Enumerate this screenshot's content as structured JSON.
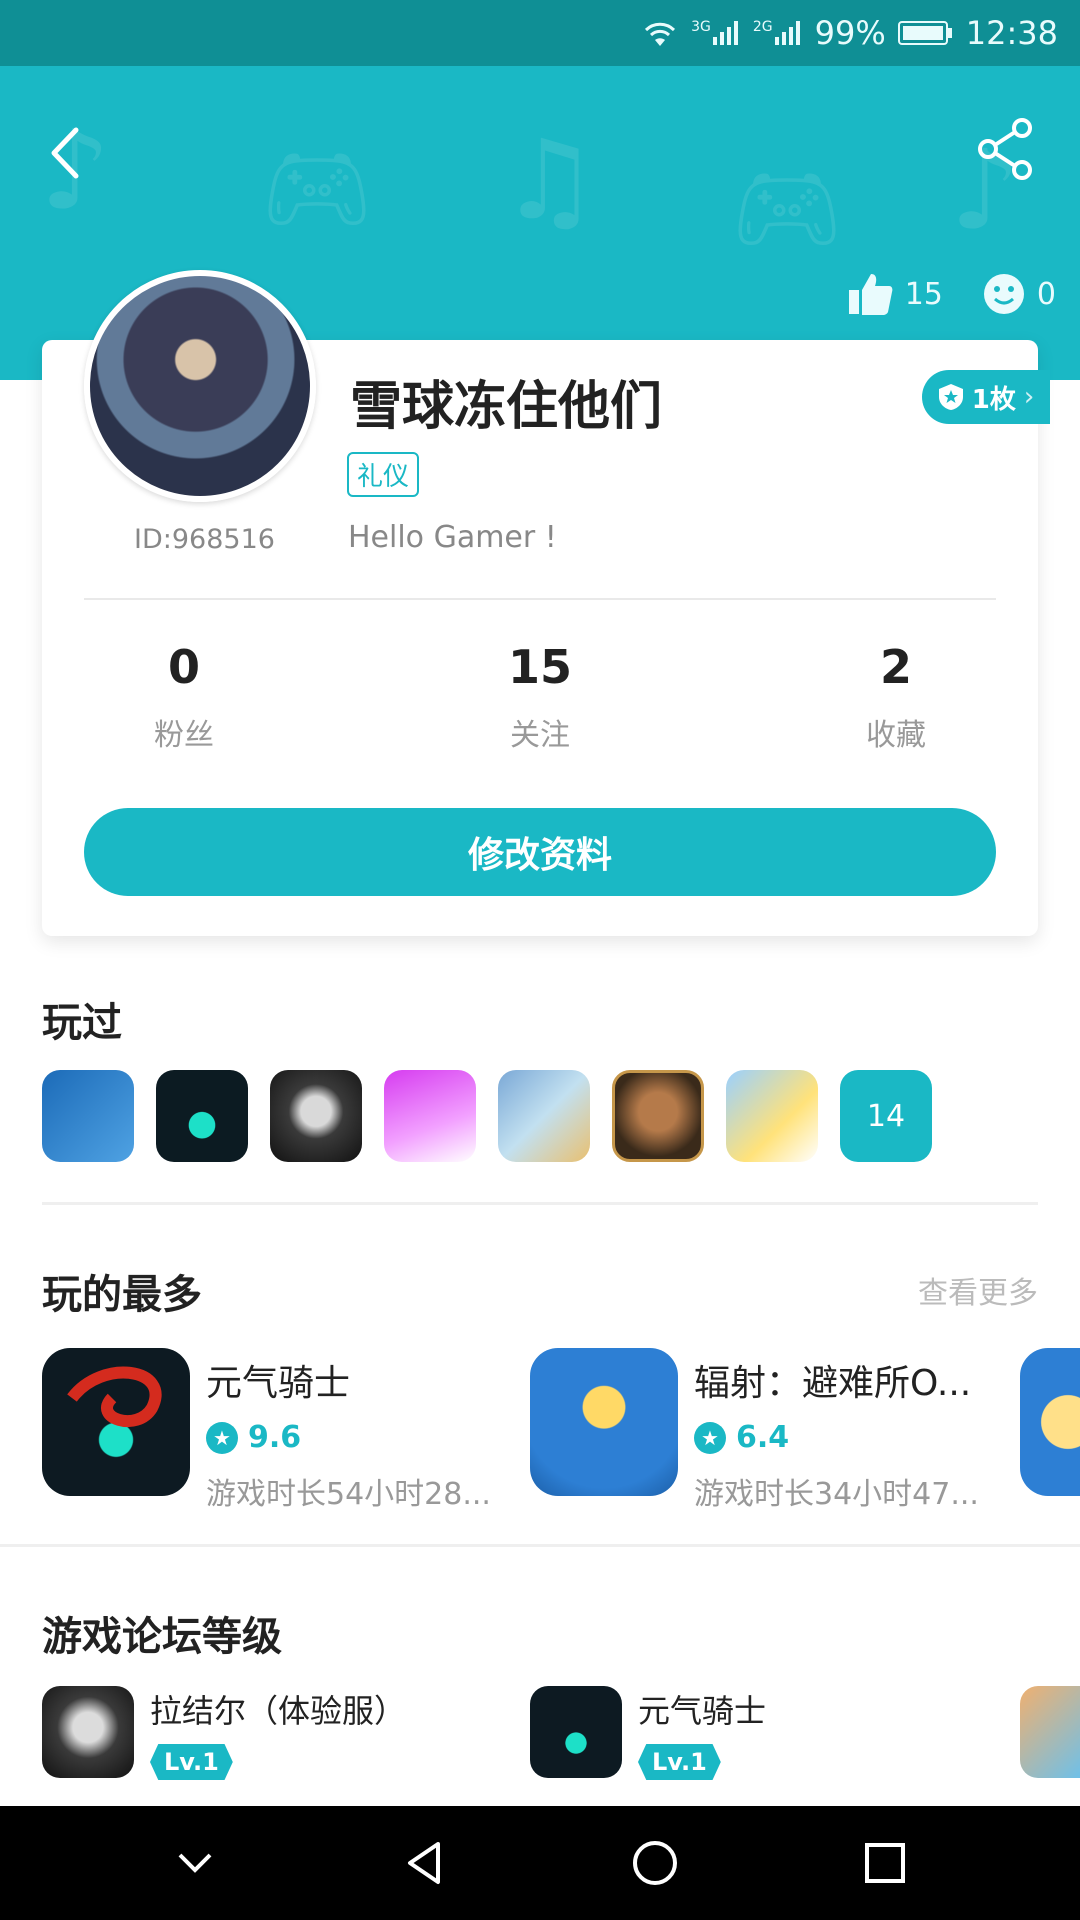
{
  "status_bar": {
    "signal_3g": "3G",
    "signal_2g": "2G",
    "battery": "99%",
    "time": "12:38"
  },
  "header": {
    "likes": "15",
    "smiles": "0",
    "accent_color": "#1ab8c5"
  },
  "profile": {
    "user_id": "ID:968516",
    "nickname": "雪球冻住他们",
    "tag": "礼仪",
    "signature": "Hello Gamer !",
    "badge_label": "1枚",
    "stats": [
      {
        "value": "0",
        "label": "粉丝"
      },
      {
        "value": "15",
        "label": "关注"
      },
      {
        "value": "2",
        "label": "收藏"
      }
    ],
    "edit_button": "修改资料"
  },
  "played": {
    "title": "玩过",
    "more_count": "14"
  },
  "most_played": {
    "title": "玩的最多",
    "see_more": "查看更多",
    "items": [
      {
        "name": "元气骑士",
        "rating": "9.6",
        "time": "游戏时长54小时28..."
      },
      {
        "name": "辐射：避难所O...",
        "rating": "6.4",
        "time": "游戏时长34小时47..."
      }
    ]
  },
  "forum": {
    "title": "游戏论坛等级",
    "items": [
      {
        "name": "拉结尔（体验服）",
        "level": "Lv.1"
      },
      {
        "name": "元气骑士",
        "level": "Lv.1"
      }
    ]
  }
}
